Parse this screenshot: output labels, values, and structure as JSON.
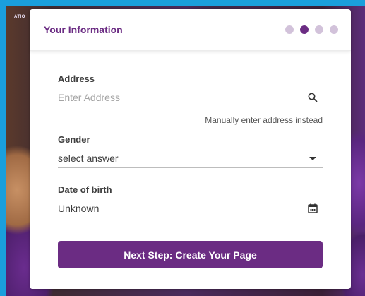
{
  "background": {
    "photo_text": "ATIO"
  },
  "card": {
    "title": "Your Information",
    "steps": {
      "count": 4,
      "active_index": 1
    }
  },
  "address": {
    "label": "Address",
    "placeholder": "Enter Address",
    "icon": "search-icon"
  },
  "manual_link": "Manually enter address instead",
  "gender": {
    "label": "Gender",
    "value": "select answer",
    "icon": "chevron-down-icon"
  },
  "dob": {
    "label": "Date of birth",
    "value": "Unknown",
    "icon": "calendar-icon"
  },
  "next_button": "Next Step: Create Your Page",
  "colors": {
    "accent": "#6b2c83",
    "inactive_dot": "#d2c2da",
    "frame_border": "#1a9fdc"
  }
}
